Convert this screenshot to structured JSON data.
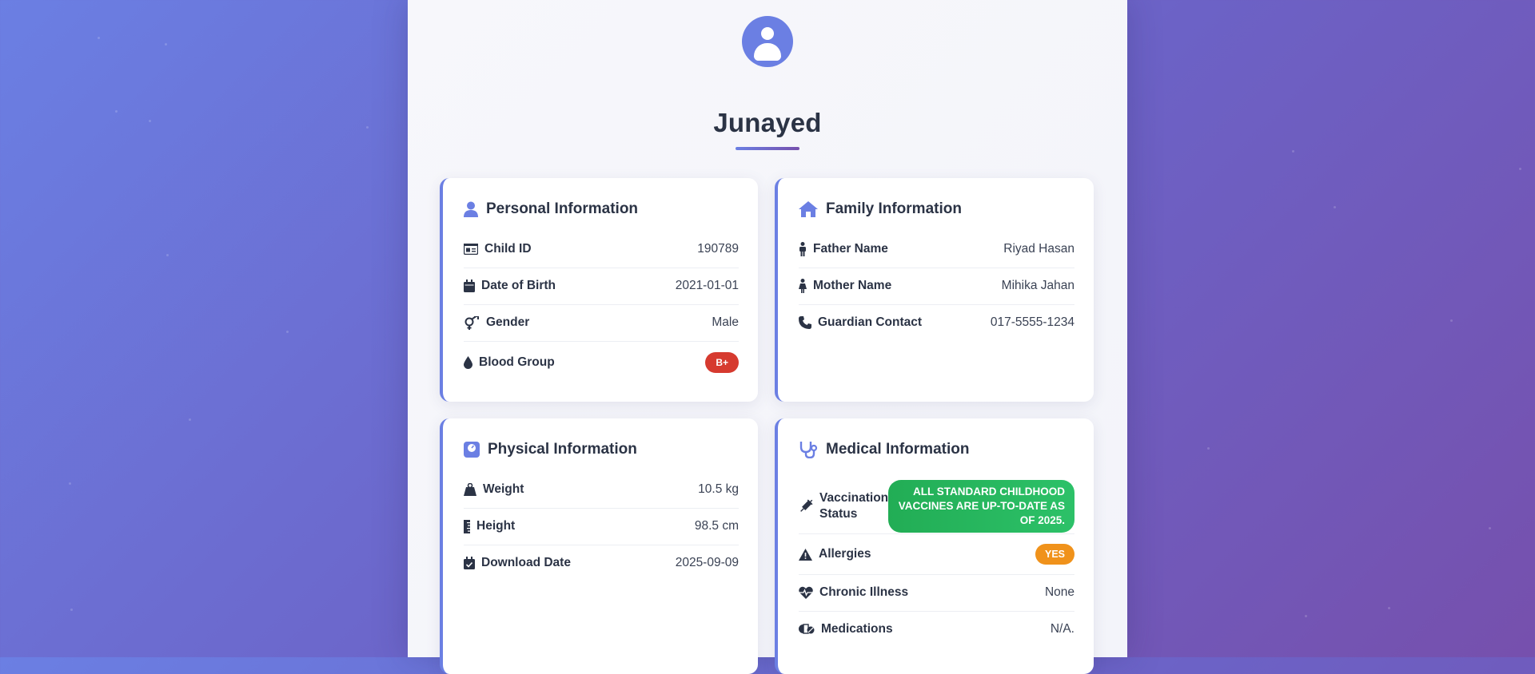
{
  "profile": {
    "name": "Junayed"
  },
  "personal": {
    "title": "Personal Information",
    "child_id_label": "Child ID",
    "child_id": "190789",
    "dob_label": "Date of Birth",
    "dob": "2021-01-01",
    "gender_label": "Gender",
    "gender": "Male",
    "blood_label": "Blood Group",
    "blood": "B+"
  },
  "family": {
    "title": "Family Information",
    "father_label": "Father Name",
    "father": "Riyad Hasan",
    "mother_label": "Mother Name",
    "mother": "Mihika Jahan",
    "contact_label": "Guardian Contact",
    "contact": "017-5555-1234"
  },
  "physical": {
    "title": "Physical Information",
    "weight_label": "Weight",
    "weight": "10.5 kg",
    "height_label": "Height",
    "height": "98.5 cm",
    "download_label": "Download Date",
    "download": "2025-09-09"
  },
  "medical": {
    "title": "Medical Information",
    "vacc_label_1": "Vaccination",
    "vacc_label_2": "Status",
    "vacc": "All standard childhood vaccines are up-to-date as of 2025.",
    "allergies_label": "Allergies",
    "allergies": "YES",
    "chronic_label": "Chronic Illness",
    "chronic": "None",
    "meds_label": "Medications",
    "meds": "N/A."
  },
  "colors": {
    "accent": "#6b7fe3",
    "accent2": "#7650ad",
    "blood_badge": "#d63a2f",
    "allergy_badge": "#f0921b",
    "vacc_badge": "#22ad55"
  }
}
